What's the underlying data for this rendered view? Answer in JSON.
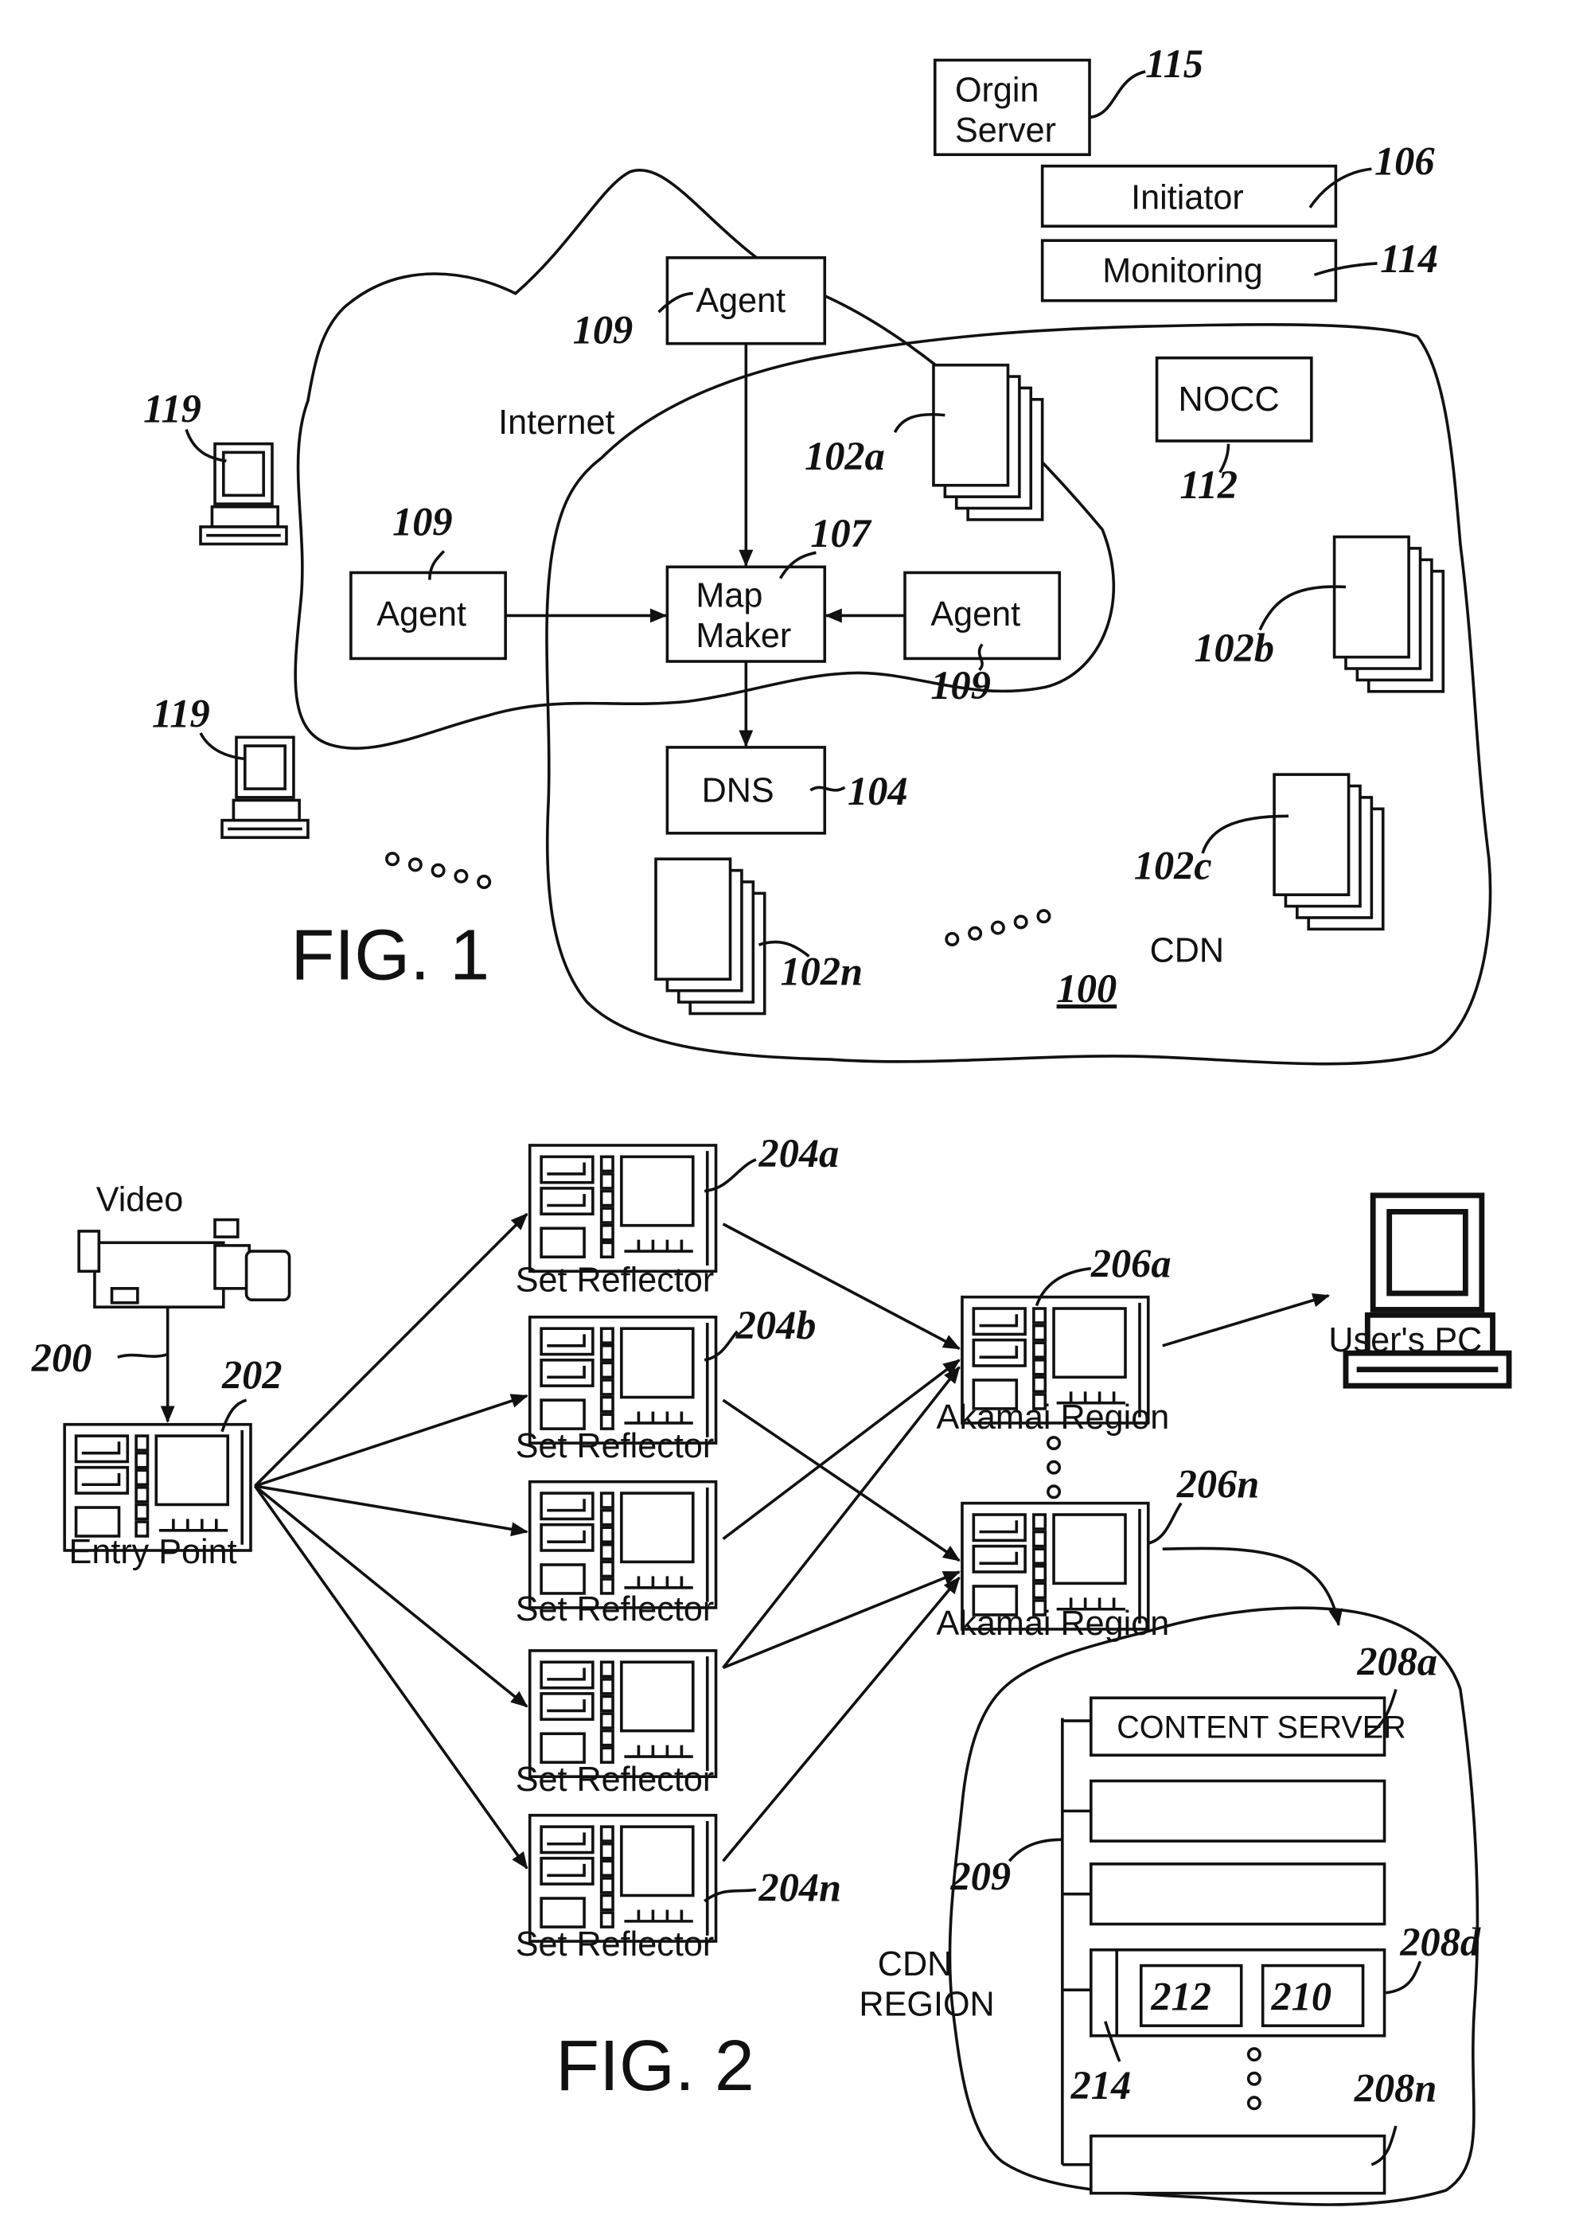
{
  "fig1": {
    "title": "FIG. 1",
    "origin_server": {
      "line1": "Orgin",
      "line2": "Server",
      "ref": "115"
    },
    "initiator": {
      "label": "Initiator",
      "ref": "106"
    },
    "monitoring": {
      "label": "Monitoring",
      "ref": "114"
    },
    "internet_label": "Internet",
    "cdn_label": "CDN",
    "cdn_ref": "100",
    "agent_top": {
      "label": "Agent",
      "ref": "109"
    },
    "agent_left": {
      "label": "Agent",
      "ref": "109"
    },
    "agent_right": {
      "label": "Agent",
      "ref": "109"
    },
    "map_maker": {
      "line1": "Map",
      "line2": "Maker",
      "ref": "107"
    },
    "dns": {
      "label": "DNS",
      "ref": "104"
    },
    "nocc": {
      "label": "NOCC",
      "ref": "112"
    },
    "server_groups": [
      "102a",
      "102b",
      "102c",
      "102n"
    ],
    "client_ref_top": "119",
    "client_ref_bottom": "119"
  },
  "fig2": {
    "title": "FIG. 2",
    "video_label": "Video",
    "video_ref": "200",
    "entry_point": {
      "label": "Entry Point",
      "ref": "202"
    },
    "set_reflectors": [
      {
        "label": "Set Reflector",
        "ref": "204a"
      },
      {
        "label": "Set Reflector",
        "ref": "204b"
      },
      {
        "label": "Set Reflector",
        "ref": ""
      },
      {
        "label": "Set Reflector",
        "ref": ""
      },
      {
        "label": "Set Reflector",
        "ref": "204n"
      }
    ],
    "akamai_regions": [
      {
        "label": "Akamai Region",
        "ref": "206a"
      },
      {
        "label": "Akamai Region",
        "ref": "206n"
      }
    ],
    "users_pc": "User's PC",
    "cdn_region": {
      "line1": "CDN",
      "line2": "REGION"
    },
    "content_server": {
      "label": "CONTENT SERVER",
      "ref": "208a"
    },
    "bus_ref": "209",
    "server_d": {
      "ref": "208d",
      "inner1": "212",
      "inner2": "210",
      "side_ref": "214"
    },
    "server_n_ref": "208n"
  }
}
